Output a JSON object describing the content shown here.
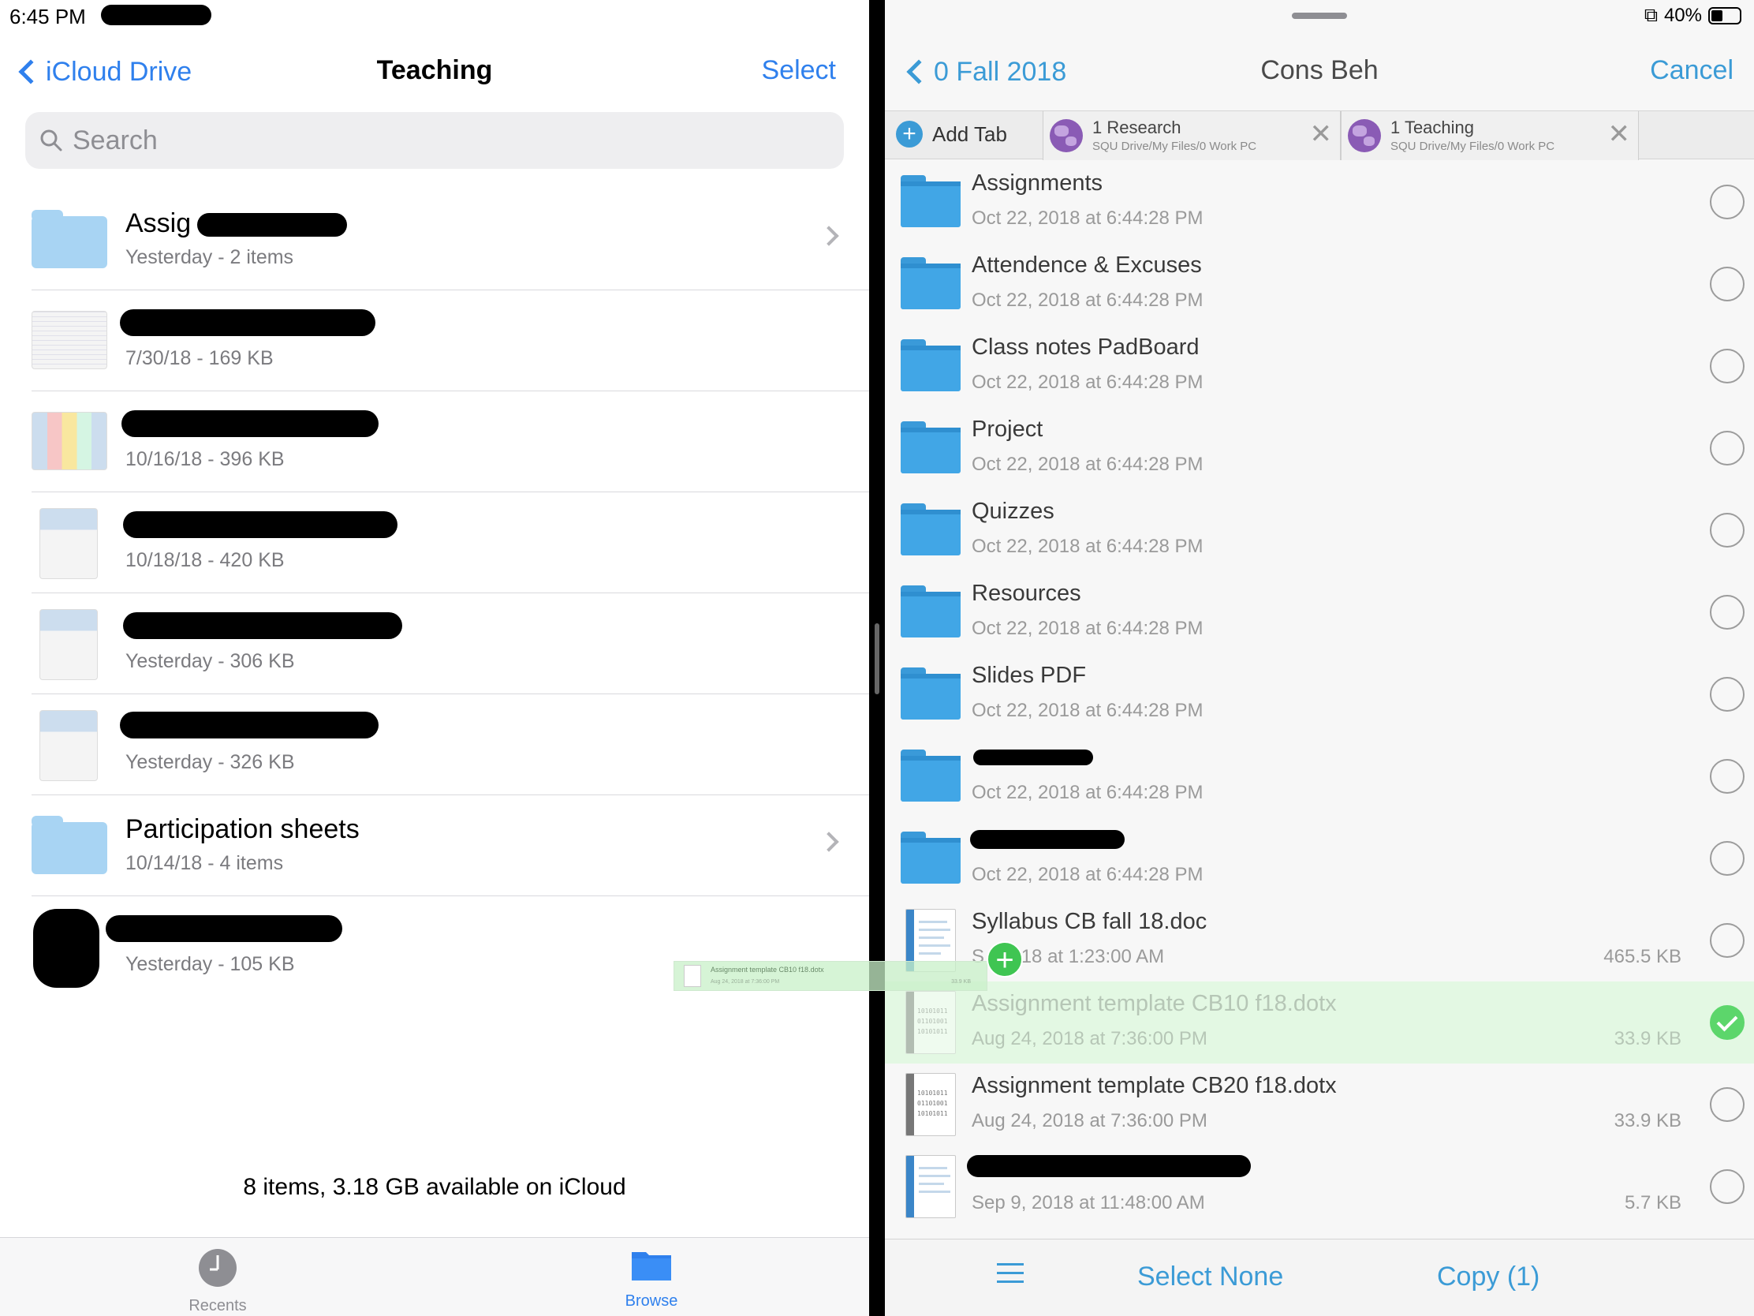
{
  "left": {
    "status_time": "6:45 PM",
    "nav": {
      "back_label": "iCloud Drive",
      "title": "Teaching",
      "select_label": "Select"
    },
    "search": {
      "placeholder": "Search"
    },
    "items": [
      {
        "name": "Assig",
        "meta": "Yesterday - 2 items",
        "type": "folder"
      },
      {
        "name": "",
        "meta": "7/30/18 - 169 KB",
        "type": "spreadsheet"
      },
      {
        "name": "",
        "meta": "10/16/18 - 396 KB",
        "type": "spreadsheet"
      },
      {
        "name": "",
        "meta": "10/18/18 - 420 KB",
        "type": "spreadsheet"
      },
      {
        "name": "",
        "meta": "Yesterday - 306 KB",
        "type": "spreadsheet"
      },
      {
        "name": "",
        "meta": "Yesterday - 326 KB",
        "type": "spreadsheet"
      },
      {
        "name": "Participation sheets",
        "meta": "10/14/18 - 4 items",
        "type": "folder"
      },
      {
        "name": "",
        "meta": "Yesterday - 105 KB",
        "type": "document"
      }
    ],
    "footer": "8 items, 3.18 GB available on iCloud",
    "tabbar": {
      "recents": "Recents",
      "browse": "Browse"
    },
    "colors": {
      "accent": "#2f80ed"
    }
  },
  "drag_ghost": {
    "name": "Assignment template CB10 f18.dotx",
    "sub": "Aug 24, 2018 at 7:36:00 PM",
    "size": "33.9 KB"
  },
  "right": {
    "battery": "40%",
    "nav": {
      "back_label": "0 Fall 2018",
      "title": "Cons Beh",
      "cancel_label": "Cancel"
    },
    "tabstrip": {
      "add_label": "Add Tab",
      "tabs": [
        {
          "name": "1 Research",
          "path": "SQU Drive/My Files/0 Work PC"
        },
        {
          "name": "1 Teaching",
          "path": "SQU Drive/My Files/0 Work PC"
        }
      ]
    },
    "items": [
      {
        "name": "Assignments",
        "date": "Oct 22, 2018 at 6:44:28 PM",
        "size": "",
        "type": "folder",
        "checked": false
      },
      {
        "name": "Attendence & Excuses",
        "date": "Oct 22, 2018 at 6:44:28 PM",
        "size": "",
        "type": "folder",
        "checked": false
      },
      {
        "name": "Class notes PadBoard",
        "date": "Oct 22, 2018 at 6:44:28 PM",
        "size": "",
        "type": "folder",
        "checked": false
      },
      {
        "name": "Project",
        "date": "Oct 22, 2018 at 6:44:28 PM",
        "size": "",
        "type": "folder",
        "checked": false
      },
      {
        "name": "Quizzes",
        "date": "Oct 22, 2018 at 6:44:28 PM",
        "size": "",
        "type": "folder",
        "checked": false
      },
      {
        "name": "Resources",
        "date": "Oct 22, 2018 at 6:44:28 PM",
        "size": "",
        "type": "folder",
        "checked": false
      },
      {
        "name": "Slides PDF",
        "date": "Oct 22, 2018 at 6:44:28 PM",
        "size": "",
        "type": "folder",
        "checked": false
      },
      {
        "name": "",
        "date": "Oct 22, 2018 at 6:44:28 PM",
        "size": "",
        "type": "folder",
        "checked": false
      },
      {
        "name": "",
        "date": "Oct 22, 2018 at 6:44:28 PM",
        "size": "",
        "type": "folder",
        "checked": false
      },
      {
        "name": "Syllabus CB fall 18.doc",
        "date": "S     , 2018 at 1:23:00 AM",
        "size": "465.5 KB",
        "type": "doc",
        "checked": false
      },
      {
        "name": "Assignment template CB10 f18.dotx",
        "date": "Aug 24, 2018 at 7:36:00 PM",
        "size": "33.9 KB",
        "type": "binary",
        "checked": true
      },
      {
        "name": "Assignment template CB20 f18.dotx",
        "date": "Aug 24, 2018 at 7:36:00 PM",
        "size": "33.9 KB",
        "type": "binary",
        "checked": false
      },
      {
        "name": "",
        "date": "Sep 9, 2018 at 11:48:00 AM",
        "size": "5.7 KB",
        "type": "doc",
        "checked": false
      }
    ],
    "toolbar": {
      "select_none": "Select None",
      "copy": "Copy (1)"
    },
    "colors": {
      "accent": "#3b9bd6",
      "selected_row": "#e3f8e3",
      "check": "#5cd66b"
    }
  }
}
